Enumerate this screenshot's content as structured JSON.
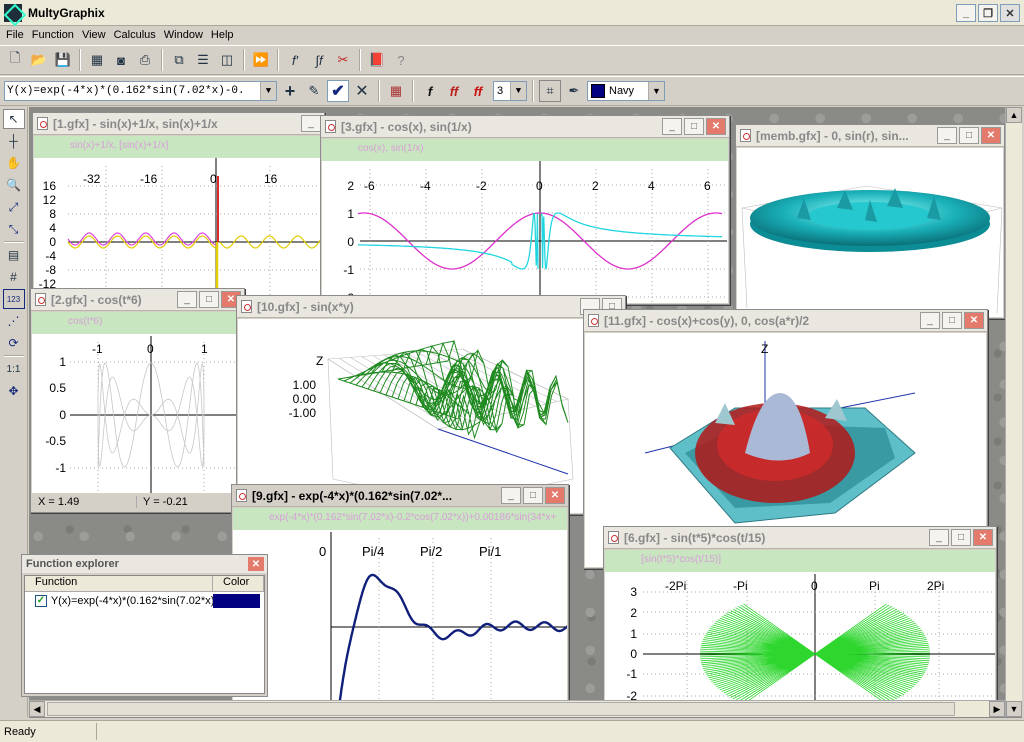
{
  "app": {
    "title": "MultyGraphix"
  },
  "menu": [
    "File",
    "Function",
    "View",
    "Calculus",
    "Window",
    "Help"
  ],
  "toolbar2": {
    "formula": "Y(x)=exp(-4*x)*(0.162*sin(7.02*x)-0.",
    "level": "3",
    "color_name": "Navy",
    "color_hex": "#000080"
  },
  "left_tools": {
    "label_11": "1:1",
    "label_123": "123"
  },
  "windows": {
    "w1": {
      "title": "[1.gfx] - sin(x)+1/x, sin(x)+1/x",
      "legend": "sin(x)+1/x, [sin(x)+1/x]",
      "xticks": [
        "-32",
        "-16",
        "0",
        "16"
      ],
      "yticks": [
        "16",
        "12",
        "8",
        "4",
        "0",
        "-4",
        "-8",
        "-12"
      ]
    },
    "w3": {
      "title": "[3.gfx] - cos(x), sin(1/x)",
      "legend": "cos(x), sin(1/x)",
      "xticks": [
        "-6",
        "-4",
        "-2",
        "0",
        "2",
        "4",
        "6"
      ],
      "yticks": [
        "2",
        "1",
        "0",
        "-1",
        "-2"
      ]
    },
    "wm": {
      "title": "[memb.gfx] - 0, sin(r), sin..."
    },
    "w2": {
      "title": "[2.gfx] - cos(t*6)",
      "legend": "cos(t*6)",
      "xticks": [
        "-1",
        "0",
        "1"
      ],
      "yticks": [
        "1",
        "0.5",
        "0",
        "-0.5",
        "-1"
      ],
      "status_x": "X = 1.49",
      "status_y": "Y = -0.21"
    },
    "w10": {
      "title": "[10.gfx] - sin(x*y)",
      "zlabel": "Z",
      "zticks": [
        "1.00",
        "0.00",
        "-1.00"
      ]
    },
    "w11": {
      "title": "[11.gfx] - cos(x)+cos(y), 0, cos(a*r)/2",
      "zlabel": "Z"
    },
    "w9": {
      "title": "[9.gfx] - exp(-4*x)*(0.162*sin(7.02*...",
      "legend": "exp(-4*x)*(0.162*sin(7.02*x)-0.2*cos(7.02*x))+0.00186*sin(34*x+",
      "xticks": [
        "0",
        "Pi/4",
        "Pi/2",
        "Pi/1"
      ]
    },
    "w6": {
      "title": "[6.gfx] - sin(t*5)*cos(t/15)",
      "legend": "[sin(t*5)*cos(t/15)]",
      "xticks": [
        "-2Pi",
        "-Pi",
        "0",
        "Pi",
        "2Pi"
      ],
      "yticks": [
        "3",
        "2",
        "1",
        "0",
        "-1",
        "-2"
      ]
    }
  },
  "function_explorer": {
    "title": "Function explorer",
    "col_function": "Function",
    "col_color": "Color",
    "row_label": "Y(x)=exp(-4*x)*(0.162*sin(7.02*x)...",
    "row_color": "#000080"
  },
  "status": {
    "text": "Ready"
  }
}
